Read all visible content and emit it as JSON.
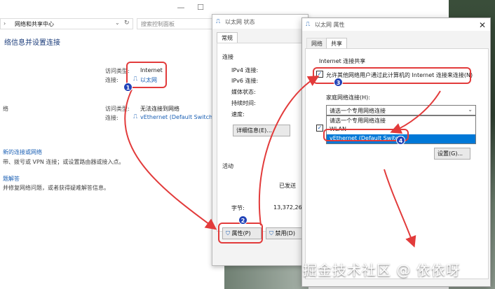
{
  "background_window": {
    "breadcrumb": "网络和共享中心",
    "search_placeholder": "搜索控制面板",
    "heading": "络信息并设置连接",
    "conn1": {
      "access_type_label": "访问类型:",
      "access_type_value": "Internet",
      "connection_label": "连接:",
      "connection_value": "以太网"
    },
    "conn2": {
      "side_label": "络",
      "access_type_label": "访问类型:",
      "access_type_value": "无法连接到网络",
      "connection_label": "连接:",
      "connection_value": "vEthernet (Default Switch)"
    },
    "link1_title": "新的连接或网络",
    "link1_desc": "带、拨号或 VPN 连接；或设置路由器或接入点。",
    "link2_title": "题解答",
    "link2_desc": "并修复网络问题，或者获得疑难解答信息。",
    "min_glyph": "—",
    "max_glyph": "☐"
  },
  "status_dialog": {
    "title": "以太网 状态",
    "tab_general": "常规",
    "section_connection": "连接",
    "ipv4": "IPv4 连接:",
    "ipv6": "IPv6 连接:",
    "media_state": "媒体状态:",
    "duration": "持续时间:",
    "speed": "速度:",
    "details_button": "详细信息(E)...",
    "section_activity": "活动",
    "sent_label": "已发送",
    "bytes_label": "字节:",
    "bytes_value": "13,372,26",
    "properties_button": "属性(P)",
    "disable_button": "禁用(D)"
  },
  "properties_dialog": {
    "title": "以太网 属性",
    "tab_network": "网络",
    "tab_sharing": "共享",
    "group_title": "Internet 连接共享",
    "allow_checkbox_label": "允许其他网络用户通过此计算机的 Internet 连接来连接(N)",
    "home_network_label": "家庭网络连接(H):",
    "select_value": "请选一个专用网络连接",
    "dropdown_options": [
      "请选一个专用网络连接",
      "WLAN",
      "vEthernet (Default Switch)"
    ],
    "settings_button": "设置(G)...",
    "close_glyph": "✕",
    "check_glyph": "✓"
  },
  "annotations": {
    "badges": [
      "1",
      "2",
      "3",
      "4"
    ],
    "watermark": "掘金技术社区 @ 依依呀"
  },
  "colors": {
    "annotation_red": "#e23b3b",
    "badge_blue": "#2243b8",
    "selection_blue": "#0078d7",
    "link_blue": "#1a5fb4"
  }
}
